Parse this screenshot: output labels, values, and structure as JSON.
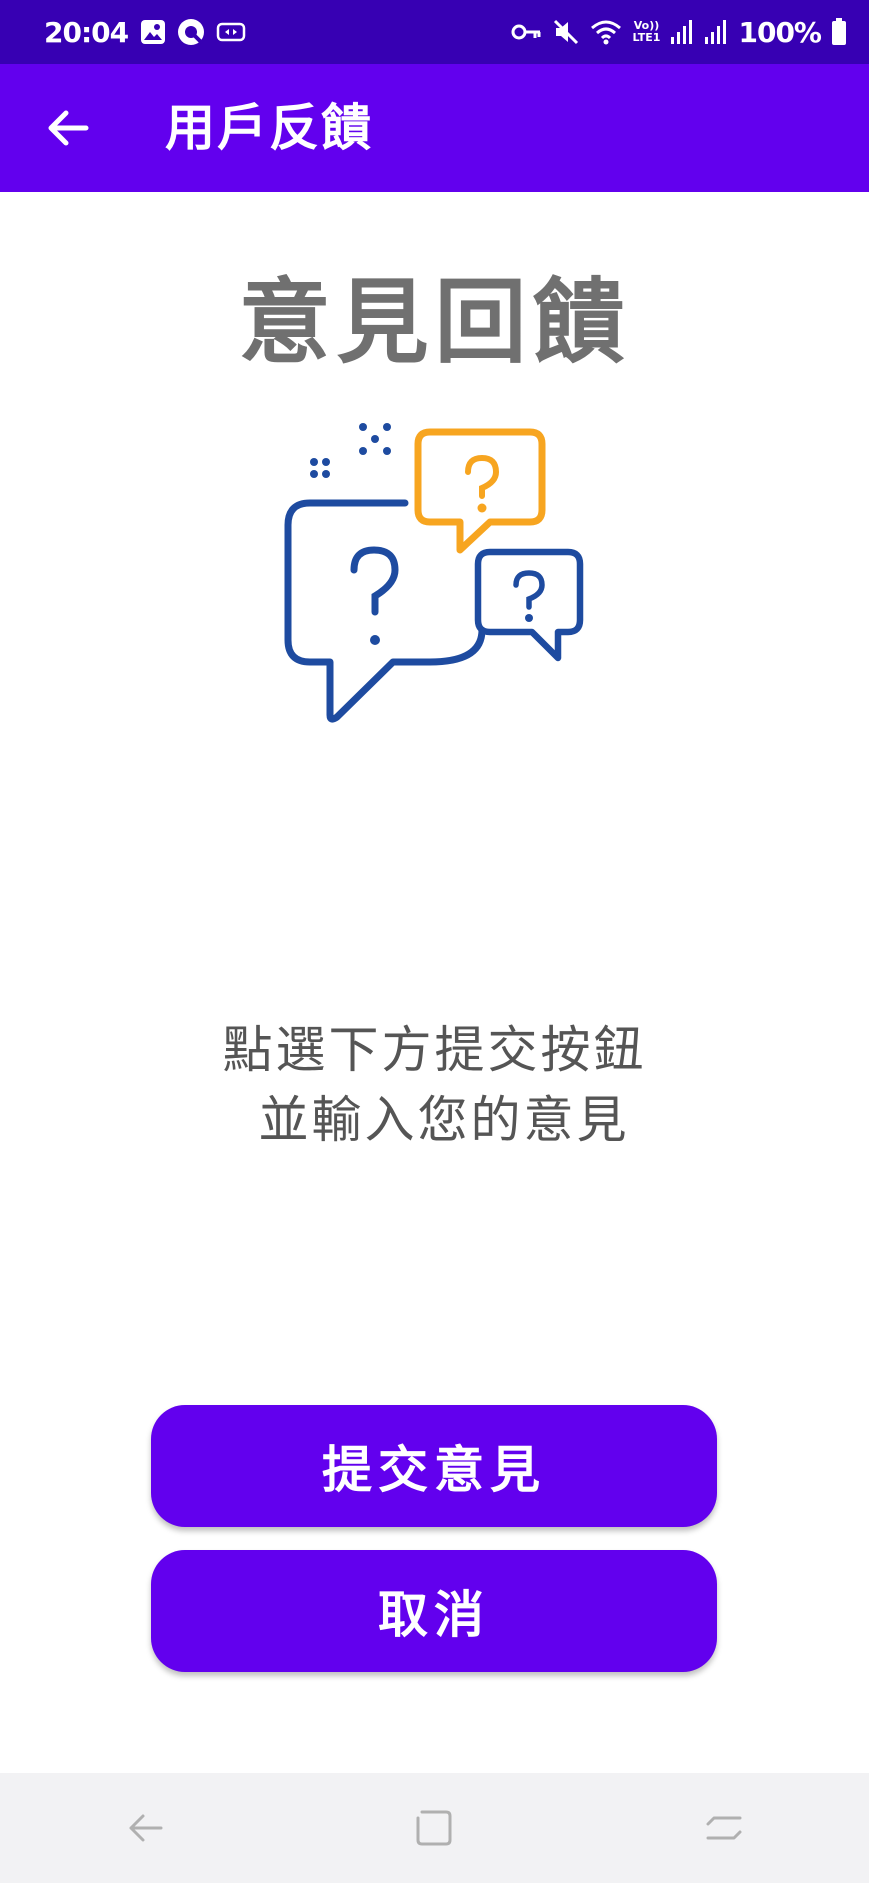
{
  "status_bar": {
    "time": "20:04",
    "battery": "100%",
    "icons_left": [
      "image-icon",
      "q-app-icon",
      "cast-icon"
    ],
    "icons_right": [
      "key-icon",
      "mute-icon",
      "wifi-icon",
      "volte-icon",
      "signal-icon",
      "signal-icon",
      "battery-icon"
    ],
    "volte_label": "Vo)) LTE1"
  },
  "app_bar": {
    "title": "用戶反饋",
    "back_icon": "arrow-left-icon"
  },
  "main": {
    "heading": "意見回饋",
    "illustration": "question-bubbles-icon",
    "instruction_line1": "點選下方提交按鈕",
    "instruction_line2": " 並輸入您的意見"
  },
  "buttons": {
    "submit_label": "提交意見",
    "cancel_label": "取消"
  },
  "nav_bar": {
    "icons": [
      "nav-back-icon",
      "nav-home-icon",
      "nav-recents-icon"
    ]
  },
  "colors": {
    "status_bar": "#3700B3",
    "primary": "#6200EE",
    "heading_text": "#707070",
    "body_text": "#555555",
    "illustration_blue": "#1E4BA0",
    "illustration_orange": "#F7A520"
  }
}
